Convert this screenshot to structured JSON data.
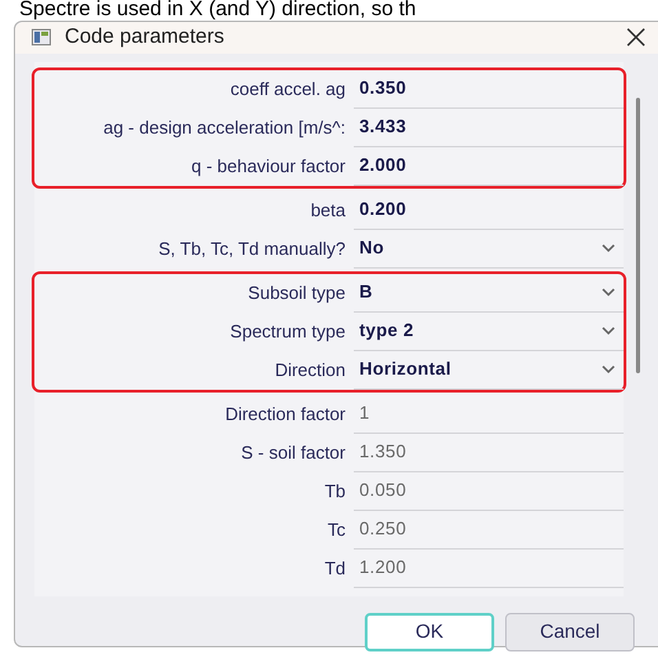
{
  "background_text": "Spectre is used in X (and Y) direction, so th",
  "window": {
    "title": "Code parameters"
  },
  "groups": [
    {
      "highlighted": true,
      "rows": [
        {
          "label": "coeff accel. ag",
          "value": "0.350",
          "kind": "number",
          "read_only": false
        },
        {
          "label": "ag - design acceleration [m/s^:",
          "value": "3.433",
          "kind": "number",
          "read_only": false
        },
        {
          "label": "q - behaviour factor",
          "value": "2.000",
          "kind": "number",
          "read_only": false
        }
      ]
    },
    {
      "highlighted": false,
      "rows": [
        {
          "label": "beta",
          "value": "0.200",
          "kind": "number",
          "read_only": false
        },
        {
          "label": "S, Tb, Tc, Td manually?",
          "value": "No",
          "kind": "dropdown",
          "read_only": false
        }
      ]
    },
    {
      "highlighted": true,
      "rows": [
        {
          "label": "Subsoil type",
          "value": "B",
          "kind": "dropdown",
          "read_only": false
        },
        {
          "label": "Spectrum type",
          "value": "type 2",
          "kind": "dropdown",
          "read_only": false
        },
        {
          "label": "Direction",
          "value": "Horizontal",
          "kind": "dropdown",
          "read_only": false
        }
      ]
    },
    {
      "highlighted": false,
      "rows": [
        {
          "label": "Direction factor",
          "value": "1",
          "kind": "number",
          "read_only": true
        },
        {
          "label": "S - soil factor",
          "value": "1.350",
          "kind": "number",
          "read_only": true
        },
        {
          "label": "Tb",
          "value": "0.050",
          "kind": "number",
          "read_only": true
        },
        {
          "label": "Tc",
          "value": "0.250",
          "kind": "number",
          "read_only": true
        },
        {
          "label": "Td",
          "value": "1.200",
          "kind": "number",
          "read_only": true
        }
      ]
    }
  ],
  "buttons": [
    {
      "label": "OK",
      "selected": true
    },
    {
      "label": "Cancel",
      "selected": false
    }
  ]
}
